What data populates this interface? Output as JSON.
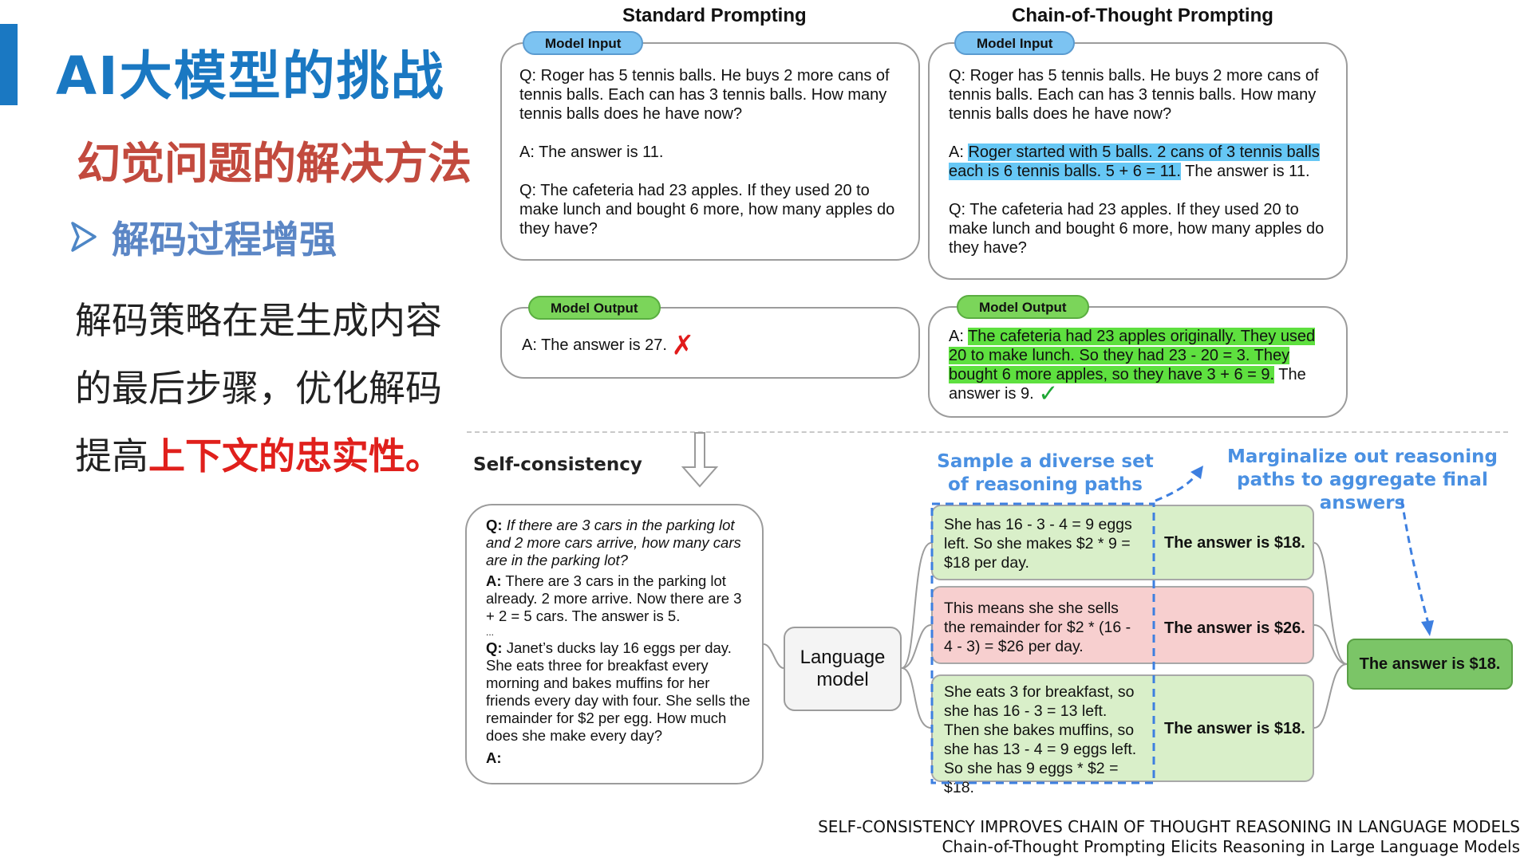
{
  "slide": {
    "title": "AI大模型的挑战",
    "subtitle": "幻觉问题的解决方法",
    "bullet": "解码过程增强",
    "body_line1": "解码策略在是生成内容",
    "body_line2": "的最后步骤，优化解码",
    "body_line3_prefix": "提高",
    "body_line3_emphasis": "上下文的忠实性。",
    "bullet_icon": "arrowhead-icon",
    "colors": {
      "title": "#1a78c2",
      "subtitle": "#c24a3e",
      "bullet": "#5b86c5",
      "emphasis": "#e0201c"
    }
  },
  "standard": {
    "title": "Standard Prompting",
    "input_label": "Model Input",
    "input_q1": "Q: Roger has 5 tennis balls. He buys 2 more cans of tennis balls. Each can has 3 tennis balls. How many tennis balls does he have now?",
    "input_a1": "A: The answer is 11.",
    "input_q2": "Q: The cafeteria had 23 apples. If they used 20 to make lunch and bought 6 more, how many apples do they have?",
    "output_label": "Model Output",
    "output_text": "A: The answer is 27.",
    "output_mark": "✗"
  },
  "cot": {
    "title": "Chain-of-Thought Prompting",
    "input_label": "Model Input",
    "input_q1": "Q: Roger has 5 tennis balls. He buys 2 more cans of tennis balls. Each can has 3 tennis balls. How many tennis balls does he have now?",
    "input_a1_prefix": "A: ",
    "input_a1_highlight": "Roger started with 5 balls. 2 cans of 3 tennis balls each is 6 tennis balls. 5 + 6 = 11.",
    "input_a1_suffix": " The answer is 11.",
    "input_q2": "Q: The cafeteria had 23 apples. If they used 20 to make lunch and bought 6 more, how many apples do they have?",
    "output_label": "Model Output",
    "output_prefix": "A: ",
    "output_highlight": "The cafeteria had 23 apples originally. They used 20 to make lunch. So they had 23 - 20 = 3. They bought 6 more apples, so they have 3 + 6 = 9.",
    "output_suffix": " The answer is 9.",
    "output_mark": "✓"
  },
  "self_consistency": {
    "label": "Self-consistency",
    "prompt_q1_label": "Q:",
    "prompt_q1": " If there are 3 cars in the parking lot and 2 more cars arrive, how many cars are in the parking lot?",
    "prompt_a1_label": "A:",
    "prompt_a1": " There are 3 cars in the parking lot already. 2 more arrive. Now there are 3 + 2 = 5 cars. The answer is 5.",
    "ellipsis": "...",
    "prompt_q2_label": "Q:",
    "prompt_q2": " Janet’s ducks lay 16 eggs per day. She eats three for breakfast every morning and bakes muffins for her friends every day with four. She sells the remainder for $2 per egg. How much does she make every day?",
    "prompt_a2_label": "A:",
    "language_model": "Language model",
    "sample_label": "Sample a diverse set of reasoning paths",
    "marginalize_label": "Marginalize out reasoning paths to aggregate final answers",
    "paths": [
      {
        "reasoning": "She has 16 - 3 - 4 = 9 eggs left. So she makes $2 * 9 = $18 per day.",
        "answer": "The answer is $18.",
        "color": "#d9efc9"
      },
      {
        "reasoning": "This means she she sells the remainder for $2 * (16 - 4 - 3) = $26 per day.",
        "answer": "The answer is $26.",
        "color": "#f7cfcf"
      },
      {
        "reasoning": "She eats 3 for breakfast, so she has 16 - 3 = 13 left. Then she bakes muffins, so she has 13 - 4 = 9 eggs left. So she has 9 eggs * $2 = $18.",
        "answer": "The answer is $18.",
        "color": "#d9efc9"
      }
    ],
    "final_answer": "The answer is $18."
  },
  "footer": {
    "line1": "SELF-CONSISTENCY IMPROVES CHAIN OF THOUGHT REASONING IN LANGUAGE MODELS",
    "line2": "Chain-of-Thought Prompting Elicits Reasoning in Large Language Models"
  }
}
